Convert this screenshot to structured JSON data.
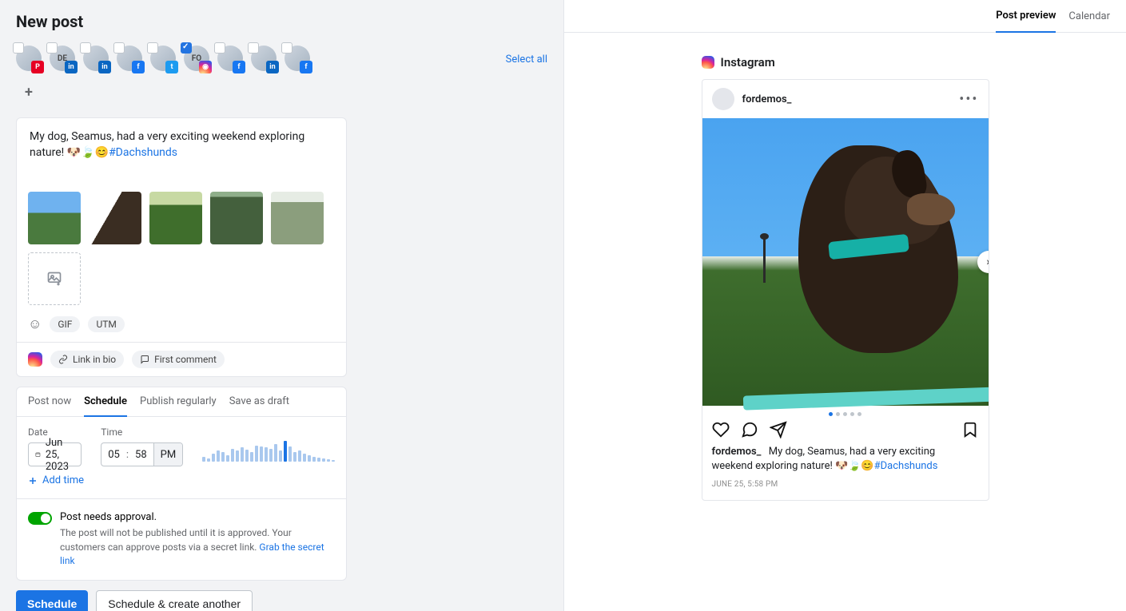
{
  "page": {
    "title": "New post"
  },
  "accounts": {
    "select_all": "Select all",
    "items": [
      {
        "label": "",
        "network": "pi",
        "checked": false
      },
      {
        "label": "DE",
        "network": "li",
        "checked": false
      },
      {
        "label": "",
        "network": "li",
        "checked": false
      },
      {
        "label": "",
        "network": "fb",
        "checked": false
      },
      {
        "label": "",
        "network": "tw",
        "checked": false
      },
      {
        "label": "FO",
        "network": "ig",
        "checked": true
      },
      {
        "label": "",
        "network": "fb",
        "checked": false
      },
      {
        "label": "",
        "network": "li",
        "checked": false
      },
      {
        "label": "",
        "network": "fb",
        "checked": false
      }
    ]
  },
  "composer": {
    "text": "My dog, Seamus, had a very exciting weekend exploring nature! 🐶🍃😊",
    "hashtag": "#Dachshunds",
    "tools": {
      "gif": "GIF",
      "utm": "UTM"
    },
    "link_in_bio": "Link in bio",
    "first_comment": "First comment"
  },
  "schedule": {
    "tabs": {
      "post_now": "Post now",
      "schedule": "Schedule",
      "publish_regularly": "Publish regularly",
      "save_draft": "Save as draft"
    },
    "date_label": "Date",
    "time_label": "Time",
    "date_value": "Jun 25, 2023",
    "time_hh": "05",
    "time_mm": "58",
    "time_ampm": "PM",
    "add_time": "Add time",
    "traffic": [
      6,
      4,
      10,
      14,
      12,
      8,
      16,
      14,
      18,
      15,
      12,
      20,
      19,
      18,
      16,
      22,
      14,
      26,
      19,
      12,
      14,
      10,
      8,
      6,
      5,
      4,
      3,
      2
    ],
    "traffic_peak_index": 17
  },
  "approval": {
    "heading": "Post needs approval.",
    "body": "The post will not be published until it is approved. Your customers can approve posts via a secret link. ",
    "link": "Grab the secret link"
  },
  "footer": {
    "schedule": "Schedule",
    "schedule_another": "Schedule & create another"
  },
  "right": {
    "tabs": {
      "preview": "Post preview",
      "calendar": "Calendar"
    },
    "preview_label": "Instagram",
    "username": "fordemos_",
    "caption_text": "My dog, Seamus, had a very exciting weekend exploring nature! 🐶🍃😊",
    "caption_hashtag": "#Dachshunds",
    "date_line": "JUNE 25, 5:58 PM",
    "slides": 5,
    "active_slide": 0
  }
}
